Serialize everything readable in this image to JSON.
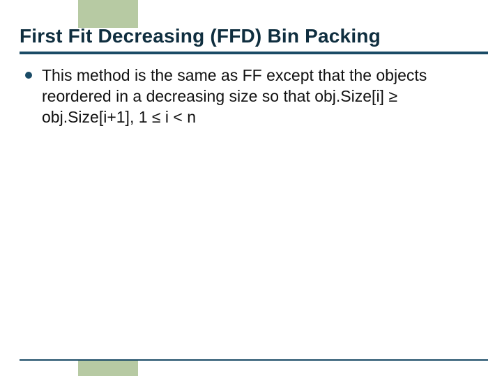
{
  "slide": {
    "title": "First Fit Decreasing (FFD) Bin Packing",
    "bullets": [
      {
        "text": "This method is the same as FF except that the objects reordered in a decreasing size so that obj.Size[i] ≥ obj.Size[i+1], 1 ≤ i < n"
      }
    ]
  }
}
